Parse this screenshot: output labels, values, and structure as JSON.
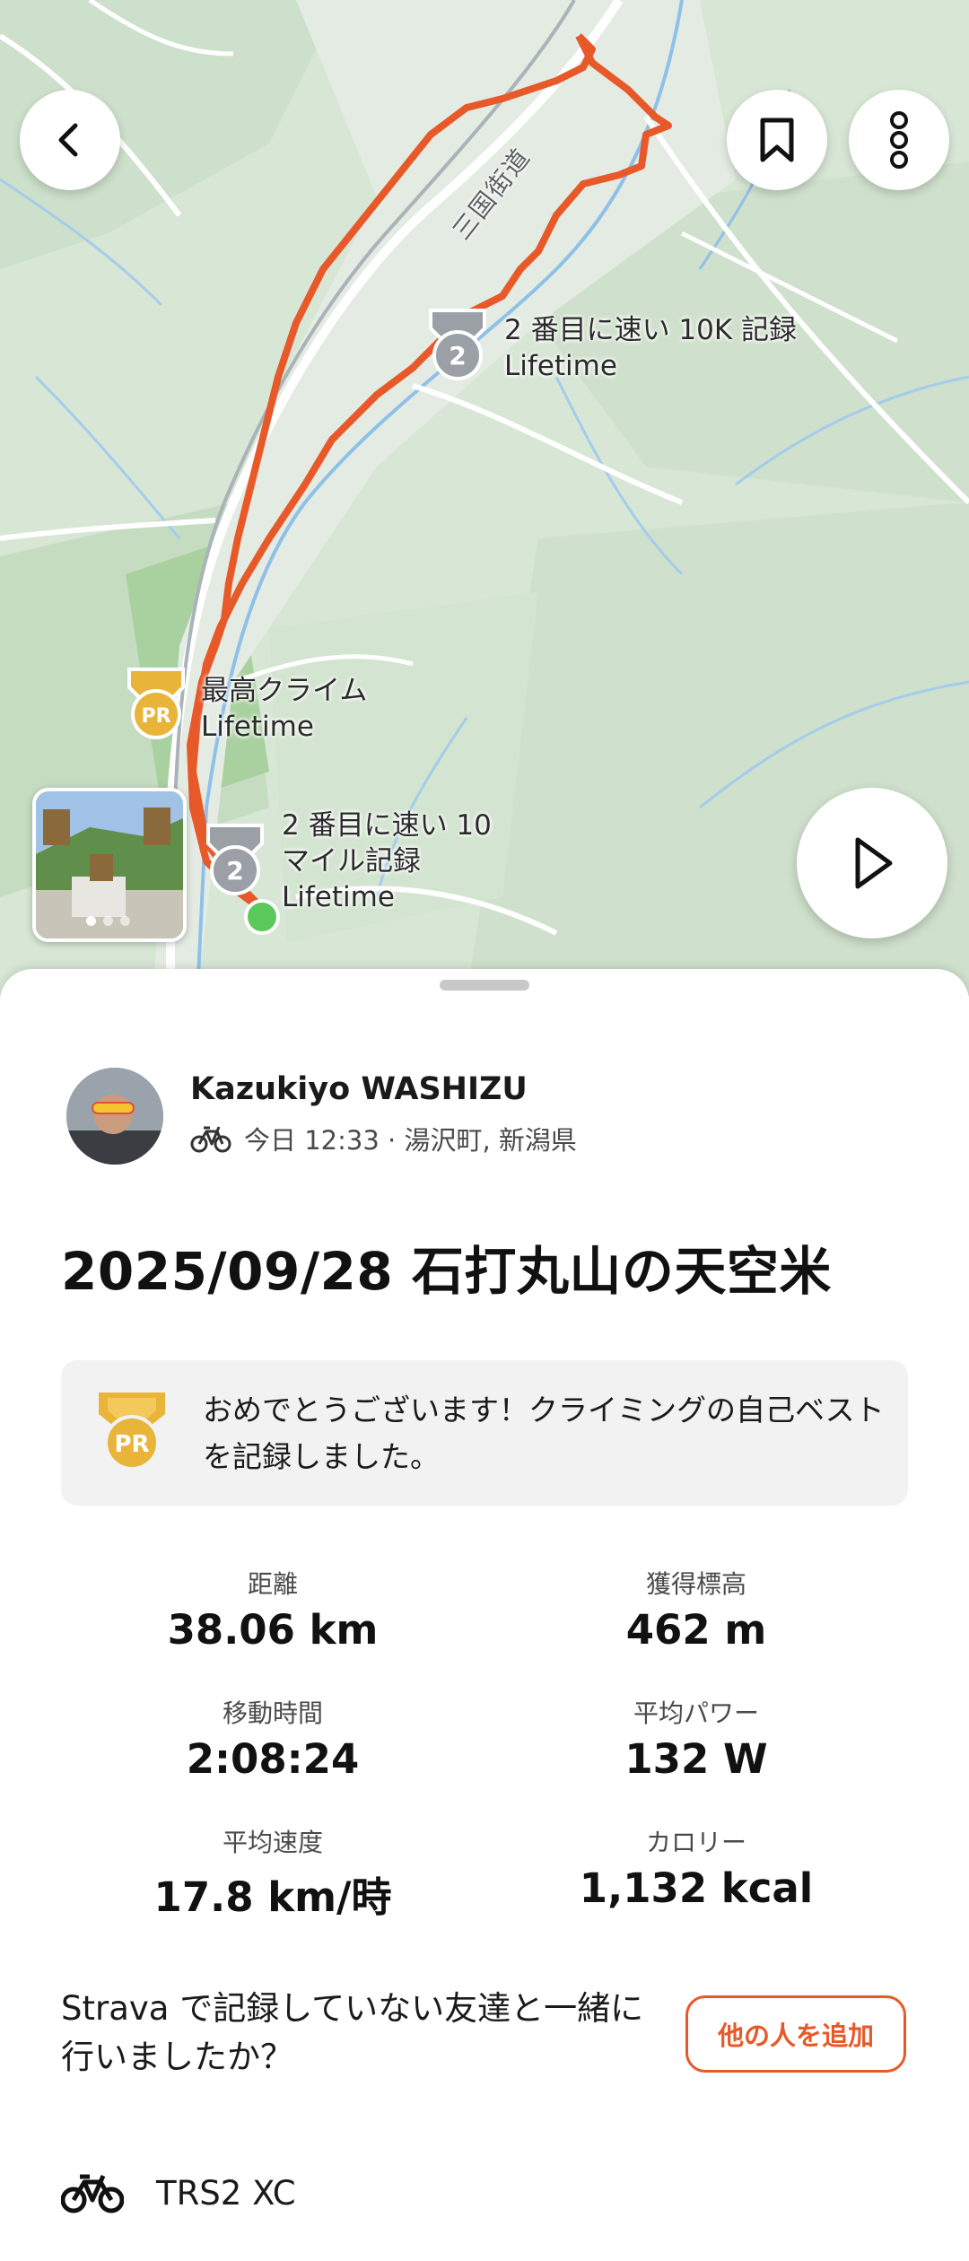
{
  "map": {
    "road_label": "三国街道",
    "achievements": [
      {
        "rank": "2",
        "line1": "2 番目に速い 10K 記録",
        "line2": "Lifetime"
      },
      {
        "rank": "PR",
        "line1": "最高クライム",
        "line2": "Lifetime"
      },
      {
        "rank": "2",
        "line1": "2 番目に速い 10",
        "line2": "マイル記録",
        "line3": "Lifetime"
      }
    ],
    "colors": {
      "route": "#e8592a",
      "start": "#5ac85a",
      "terrain": "#cfe3cf",
      "water": "#8fc1e8"
    },
    "icons": {
      "back": "chevron-left-icon",
      "save": "bookmark-icon",
      "more": "more-vertical-icon",
      "play": "play-icon"
    }
  },
  "athlete": {
    "name": "Kazukiyo WASHIZU",
    "activity_icon": "bike-icon",
    "meta": "今日 12:33 · 湯沢町, 新潟県"
  },
  "activity": {
    "title": "2025/09/28 石打丸山の天空米"
  },
  "pr_banner": {
    "badge": "PR",
    "text": "おめでとうございます！クライミングの自己ベストを記録しました。"
  },
  "stats": [
    {
      "label": "距離",
      "value": "38.06 km"
    },
    {
      "label": "獲得標高",
      "value": "462 m"
    },
    {
      "label": "移動時間",
      "value": "2:08:24"
    },
    {
      "label": "平均パワー",
      "value": "132 W"
    },
    {
      "label": "平均速度",
      "value": "17.8 km/時"
    },
    {
      "label": "カロリー",
      "value": "1,132 kcal"
    }
  ],
  "friends": {
    "question": "Strava で記録していない友達と一緒に行いましたか？",
    "button": "他の人を追加"
  },
  "gear": {
    "name": "TRS2 XC",
    "icon": "bike-icon"
  },
  "colors": {
    "accent": "#e8592a",
    "pr_gold": "#e8b53a",
    "medal_silver": "#9aa0a6"
  }
}
